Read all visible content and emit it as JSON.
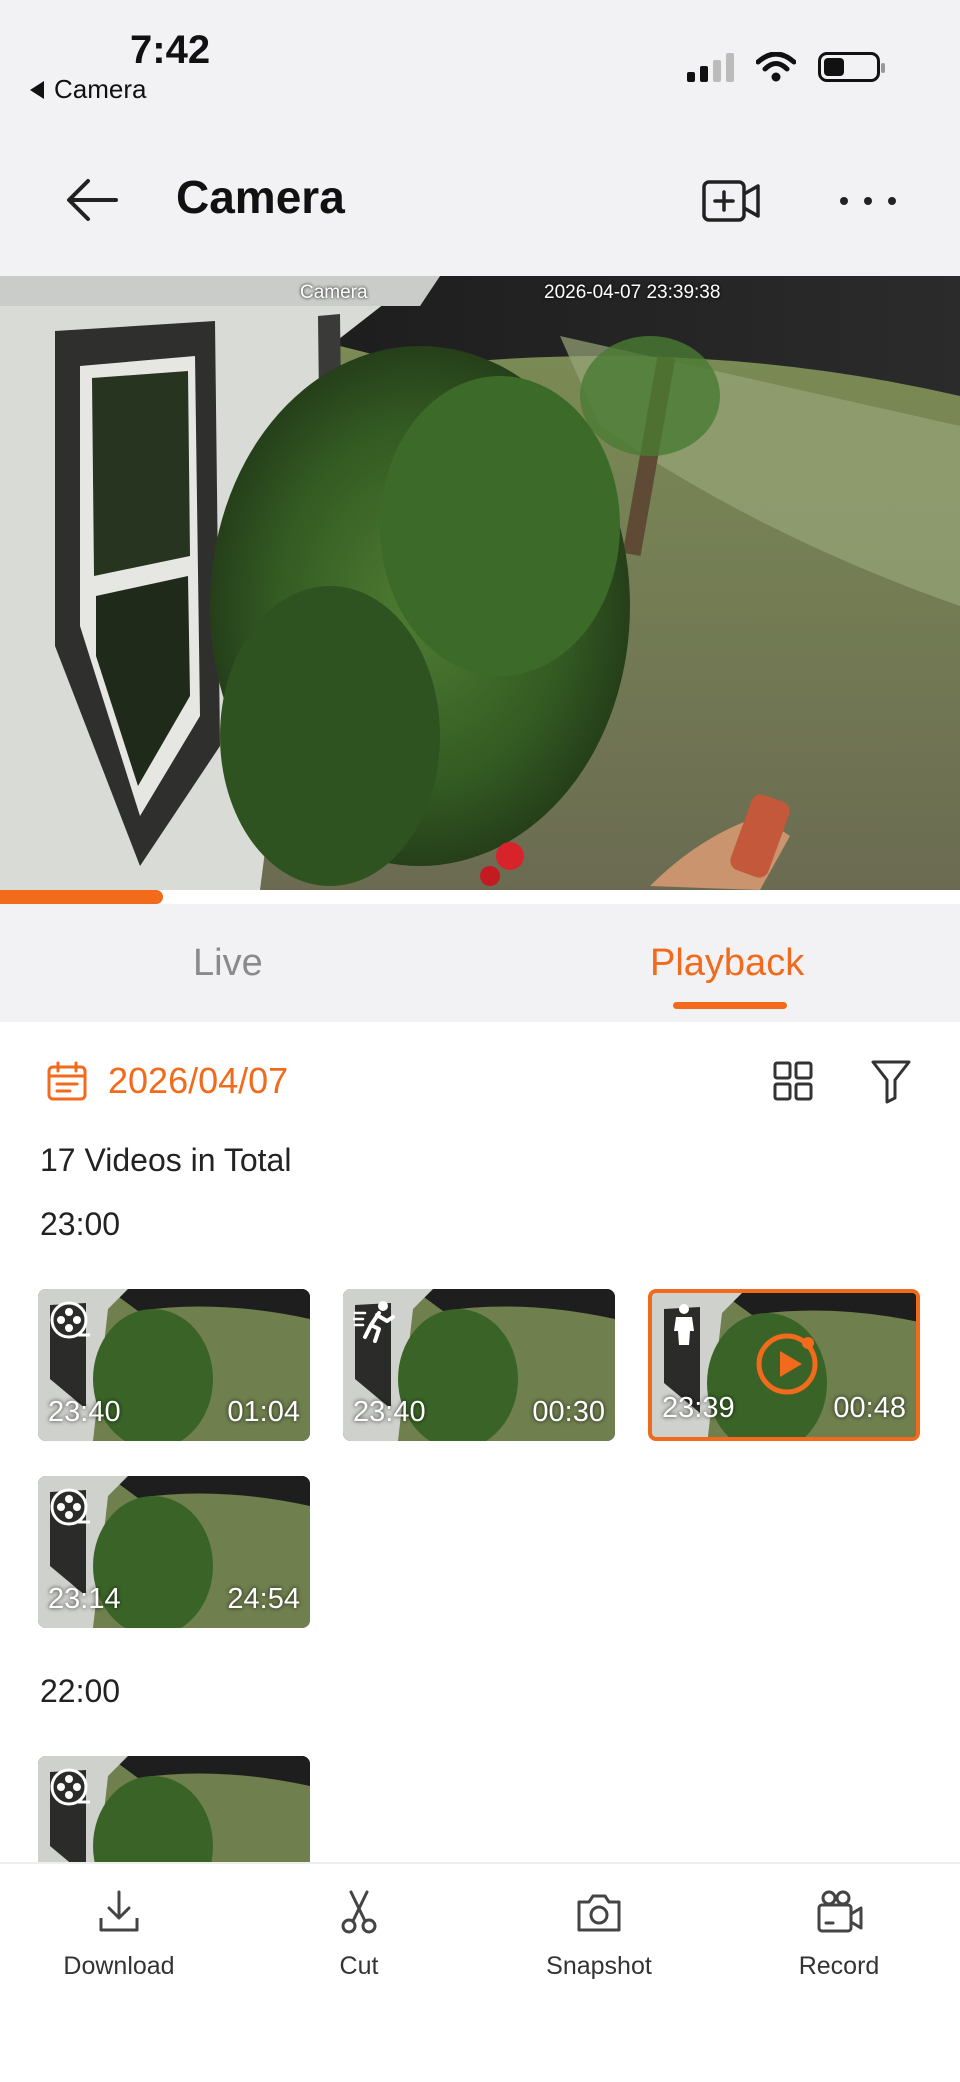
{
  "status_bar": {
    "time": "7:42",
    "back_app": "Camera"
  },
  "header": {
    "title": "Camera",
    "add_icon": "add-camera-icon",
    "more_icon": "more-icon"
  },
  "video": {
    "osd_name": "Camera",
    "osd_timestamp": "2026-04-07 23:39:38",
    "playback_progress": 0.17
  },
  "tabs": [
    {
      "label": "Live",
      "active": false
    },
    {
      "label": "Playback",
      "active": true
    }
  ],
  "filters": {
    "date": "2026/04/07"
  },
  "summary": {
    "total": "17 Videos in Total"
  },
  "groups": [
    {
      "hour": "23:00",
      "clips": [
        {
          "start": "23:40",
          "duration": "01:04",
          "type": "reel-icon",
          "selected": false
        },
        {
          "start": "23:40",
          "duration": "00:30",
          "type": "motion-icon",
          "selected": false
        },
        {
          "start": "23:39",
          "duration": "00:48",
          "type": "person-icon",
          "selected": true
        },
        {
          "start": "23:14",
          "duration": "24:54",
          "type": "reel-icon",
          "selected": false
        }
      ]
    },
    {
      "hour": "22:00",
      "clips": [
        {
          "start": "",
          "duration": "",
          "type": "reel-icon",
          "selected": false
        }
      ]
    }
  ],
  "toolbar": {
    "download": "Download",
    "cut": "Cut",
    "snapshot": "Snapshot",
    "record": "Record"
  },
  "colors": {
    "accent": "#f26a1b",
    "header_bg": "#f2f2f4",
    "text": "#222222"
  }
}
